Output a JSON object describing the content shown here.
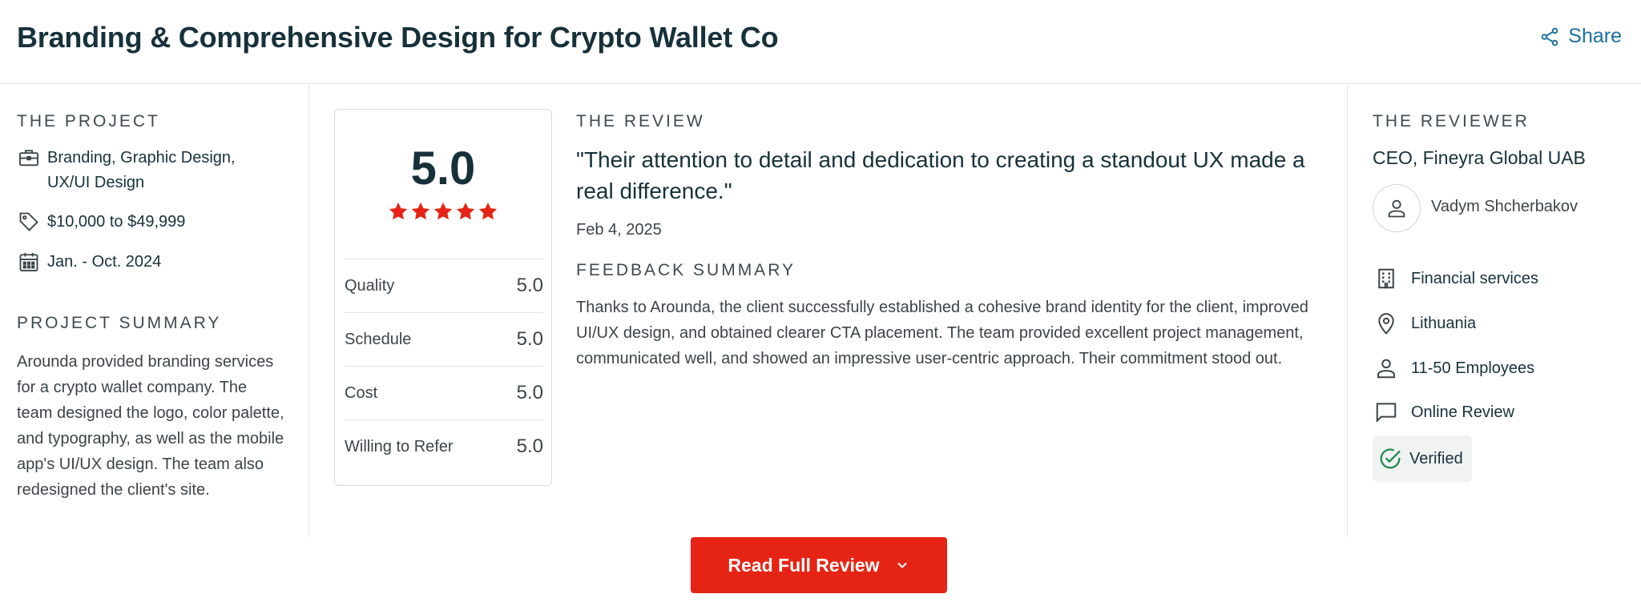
{
  "header": {
    "title": "Branding & Comprehensive Design for Crypto Wallet Co",
    "share_label": "Share"
  },
  "project": {
    "section_label": "THE PROJECT",
    "services": "Branding, Graphic Design, UX/UI Design",
    "budget": "$10,000 to $49,999",
    "dates": "Jan. - Oct. 2024",
    "summary_label": "PROJECT SUMMARY",
    "summary": "Arounda provided branding services for a crypto wallet company. The team designed the logo, color palette, and typography, as well as the mobile app's UI/UX design. The team also redesigned the client's site."
  },
  "rating": {
    "overall": "5.0",
    "stars": 5,
    "rows": [
      {
        "label": "Quality",
        "value": "5.0"
      },
      {
        "label": "Schedule",
        "value": "5.0"
      },
      {
        "label": "Cost",
        "value": "5.0"
      },
      {
        "label": "Willing to Refer",
        "value": "5.0"
      }
    ]
  },
  "review": {
    "section_label": "THE REVIEW",
    "quote": "\"Their attention to detail and dedication to creating a standout UX made a real difference.\"",
    "date": "Feb 4, 2025",
    "feedback_label": "FEEDBACK SUMMARY",
    "feedback": "Thanks to Arounda, the client successfully established a cohesive brand identity for the client, improved UI/UX design, and obtained clearer CTA placement. The team provided excellent project management, communicated well, and showed an impressive user-centric approach. Their commitment stood out."
  },
  "reviewer": {
    "section_label": "THE REVIEWER",
    "role": "CEO, Fineyra Global UAB",
    "name": "Vadym Shcherbakov",
    "industry": "Financial services",
    "location": "Lithuania",
    "size": "11-50 Employees",
    "review_type": "Online Review",
    "verified_label": "Verified"
  },
  "cta": {
    "label": "Read Full Review"
  },
  "colors": {
    "brand_red": "#e62415",
    "link_blue": "#1a6fa0",
    "text_dark": "#17313b",
    "verified_green": "#1e8a4c"
  }
}
